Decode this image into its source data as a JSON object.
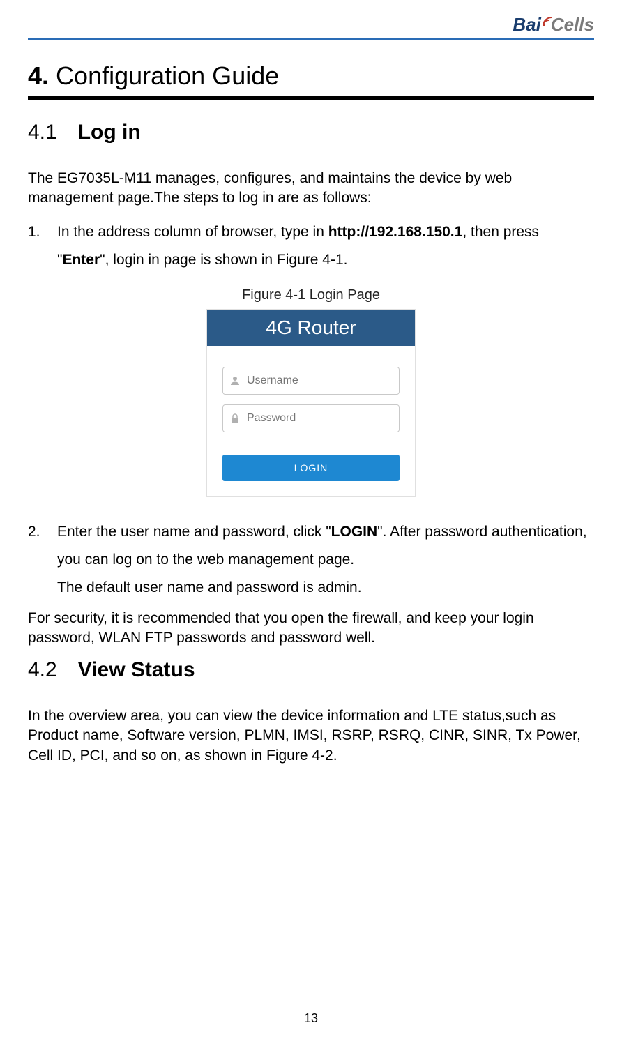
{
  "logo": {
    "part1": "Bai",
    "part2": "Cells"
  },
  "h1": {
    "num": "4.",
    "title": "Configuration Guide"
  },
  "s41": {
    "num": "4.1",
    "title": "Log in",
    "intro": "The EG7035L-M11 manages, configures, and maintains the device by web management page.The steps to log in are as follows:",
    "step1": {
      "num": "1.",
      "pre": "In the address column of browser, type in ",
      "url": "http://192.168.150.1",
      "mid": ", then press \"",
      "enter": "Enter",
      "post": "\", login in page is shown in Figure 4-1."
    },
    "figcap": "Figure 4-1 Login Page",
    "login": {
      "header": "4G Router",
      "user_ph": "Username",
      "pass_ph": "Password",
      "button": "LOGIN"
    },
    "step2": {
      "num": "2.",
      "pre": "Enter the user name and password, click \"",
      "login": "LOGIN",
      "post": "\". After password authentication, you can log on to the web management page.",
      "default": "The default user name and password is admin."
    },
    "security": "For security, it is recommended that you open the firewall, and keep your login password, WLAN FTP passwords and password well."
  },
  "s42": {
    "num": "4.2",
    "title": "View Status",
    "body": "In the overview area, you can view the device information and LTE status,such as Product name, Software version, PLMN, IMSI, RSRP, RSRQ, CINR, SINR, Tx Power, Cell ID, PCI, and so on, as shown in Figure 4-2."
  },
  "page_num": "13"
}
